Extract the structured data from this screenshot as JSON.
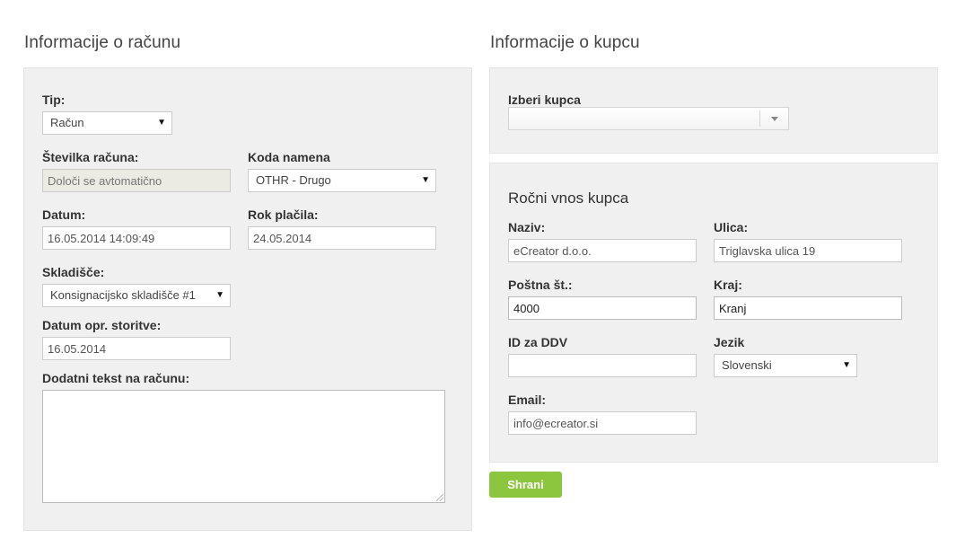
{
  "invoice_section": {
    "title": "Informacije o računu",
    "type_label": "Tip:",
    "type_value": "Račun",
    "number_label": "Številka računa:",
    "number_placeholder": "Določi se avtomatično",
    "purpose_label": "Koda namena",
    "purpose_value": "OTHR - Drugo",
    "date_label": "Datum:",
    "date_value": "16.05.2014 14:09:49",
    "due_label": "Rok plačila:",
    "due_value": "24.05.2014",
    "warehouse_label": "Skladišče:",
    "warehouse_value": "Konsignacijsko skladišče #1",
    "service_date_label": "Datum opr. storitve:",
    "service_date_value": "16.05.2014",
    "extra_text_label": "Dodatni tekst na računu:",
    "extra_text_value": ""
  },
  "customer_section": {
    "title": "Informacije o kupcu",
    "choose_label": "Izberi kupca",
    "choose_value": "",
    "manual_title": "Ročni vnos kupca",
    "name_label": "Naziv:",
    "name_value": "eCreator d.o.o.",
    "street_label": "Ulica:",
    "street_value": "Triglavska ulica 19",
    "postal_label": "Poštna št.:",
    "postal_value": "4000",
    "city_label": "Kraj:",
    "city_value": "Kranj",
    "vat_label": "ID za DDV",
    "vat_value": "",
    "language_label": "Jezik",
    "language_value": "Slovenski",
    "email_label": "Email:",
    "email_value": "info@ecreator.si"
  },
  "save_button": "Shrani",
  "colors": {
    "panel": "#f0f0f0",
    "accent": "#8cc63f"
  }
}
